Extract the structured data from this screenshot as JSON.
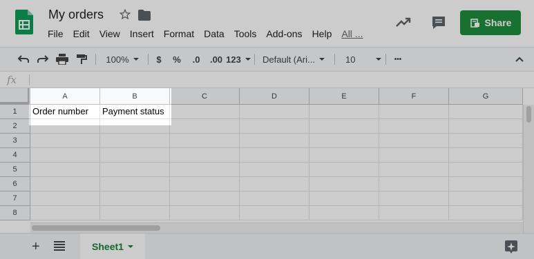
{
  "doc": {
    "title": "My orders"
  },
  "menu": [
    "File",
    "Edit",
    "View",
    "Insert",
    "Format",
    "Data",
    "Tools",
    "Add-ons",
    "Help",
    "All ..."
  ],
  "share": {
    "label": "Share"
  },
  "toolbar": {
    "zoom": "100%",
    "currency": "$",
    "percent": "%",
    "dec_decrease": ".0",
    "dec_increase": ".00",
    "more_formats": "123",
    "font": "Default (Ari...",
    "font_size": "10",
    "more": "•••"
  },
  "formula": {
    "icon": "fx"
  },
  "columns": [
    "A",
    "B",
    "C",
    "D",
    "E",
    "F",
    "G"
  ],
  "rows": [
    "1",
    "2",
    "3",
    "4",
    "5",
    "6",
    "7",
    "8"
  ],
  "cells": {
    "A1": "Order number",
    "B1": "Payment status"
  },
  "sheets": [
    {
      "label": "Sheet1"
    }
  ],
  "colors": {
    "accent": "#1e8e3e",
    "sheet_tab_text": "#188038"
  },
  "icons": [
    "sheets-logo-icon",
    "star-icon",
    "folder-icon",
    "trend-icon",
    "comment-icon",
    "share-lock-icon",
    "undo-icon",
    "redo-icon",
    "print-icon",
    "paint-format-icon",
    "collapse-icon",
    "add-sheet-icon",
    "all-sheets-icon",
    "explore-icon"
  ]
}
